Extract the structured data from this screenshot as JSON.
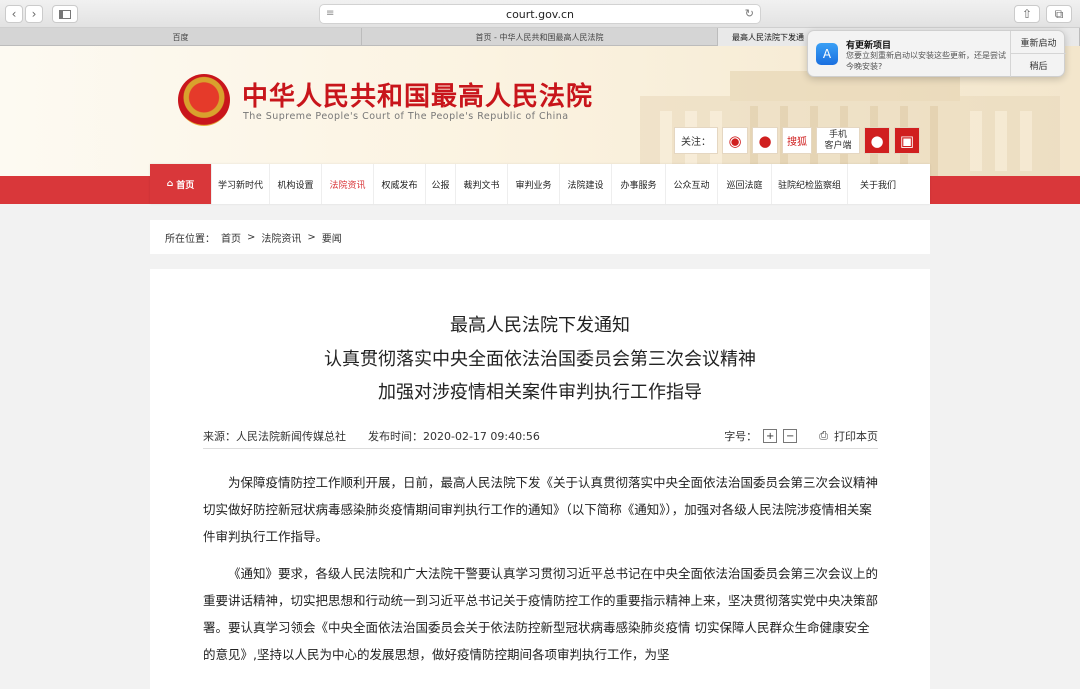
{
  "browser": {
    "url": "court.gov.cn",
    "tabs": [
      "百度",
      "首页 - 中华人民共和国最高人民法院",
      "最高人民法院下发通"
    ]
  },
  "notification": {
    "title": "有更新项目",
    "body": "您要立刻重新启动以安装这些更新，还是尝试今晚安装?",
    "restart": "重新启动",
    "later": "稍后"
  },
  "site": {
    "title_cn": "中华人民共和国最高人民法院",
    "title_en": "The Supreme People's Court of The People's Republic of China",
    "follow_label": "关注：",
    "sohu": "搜狐",
    "mobile": "手机\n客户端"
  },
  "nav": [
    "首页",
    "学习新时代",
    "机构设置",
    "法院资讯",
    "权威发布",
    "公报",
    "裁判文书",
    "审判业务",
    "法院建设",
    "办事服务",
    "公众互动",
    "巡回法庭",
    "驻院纪检监察组",
    "关于我们"
  ],
  "breadcrumb": {
    "label": "所在位置：",
    "items": [
      "首页",
      "法院资讯",
      "要闻"
    ],
    "sep": ">"
  },
  "article": {
    "title_lines": [
      "最高人民法院下发通知",
      "认真贯彻落实中央全面依法治国委员会第三次会议精神",
      "加强对涉疫情相关案件审判执行工作指导"
    ],
    "source": "来源：人民法院新闻传媒总社",
    "time": "发布时间：2020-02-17 09:40:56",
    "fontsize_label": "字号：",
    "plus": "+",
    "minus": "−",
    "print": "打印本页",
    "p1": "为保障疫情防控工作顺利开展，日前，最高人民法院下发《关于认真贯彻落实中央全面依法治国委员会第三次会议精神 切实做好防控新冠状病毒感染肺炎疫情期间审判执行工作的通知》（以下简称《通知》），加强对各级人民法院涉疫情相关案件审判执行工作指导。",
    "p2": "《通知》要求，各级人民法院和广大法院干警要认真学习贯彻习近平总书记在中央全面依法治国委员会第三次会议上的重要讲话精神，切实把思想和行动统一到习近平总书记关于疫情防控工作的重要指示精神上来，坚决贯彻落实党中央决策部署。要认真学习领会《中央全面依法治国委员会关于依法防控新型冠状病毒感染肺炎疫情 切实保障人民群众生命健康安全的意见》,坚持以人民为中心的发展思想，做好疫情防控期间各项审判执行工作，为坚"
  }
}
